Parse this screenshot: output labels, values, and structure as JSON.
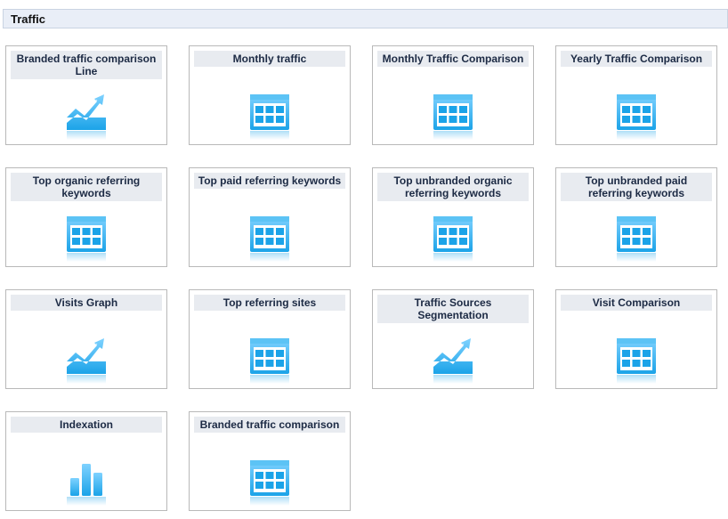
{
  "section": {
    "title": "Traffic"
  },
  "tiles": [
    {
      "label": "Branded traffic comparison Line",
      "icon": "line-chart-icon"
    },
    {
      "label": "Monthly traffic",
      "icon": "table-icon"
    },
    {
      "label": "Monthly Traffic Comparison",
      "icon": "table-icon"
    },
    {
      "label": "Yearly Traffic Comparison",
      "icon": "table-icon"
    },
    {
      "label": "Top organic referring keywords",
      "icon": "table-icon"
    },
    {
      "label": "Top paid referring keywords",
      "icon": "table-icon"
    },
    {
      "label": "Top unbranded organic referring keywords",
      "icon": "table-icon"
    },
    {
      "label": "Top unbranded paid referring keywords",
      "icon": "table-icon"
    },
    {
      "label": "Visits Graph",
      "icon": "line-chart-icon"
    },
    {
      "label": "Top referring sites",
      "icon": "table-icon"
    },
    {
      "label": "Traffic Sources Segmentation",
      "icon": "line-chart-icon"
    },
    {
      "label": "Visit Comparison",
      "icon": "table-icon"
    },
    {
      "label": "Indexation",
      "icon": "bar-chart-icon"
    },
    {
      "label": "Branded traffic comparison",
      "icon": "table-icon"
    }
  ],
  "colors": {
    "accent": "#1ba3e8",
    "accent_light": "#7fd2ff",
    "label_bg": "#e8ebf0"
  }
}
